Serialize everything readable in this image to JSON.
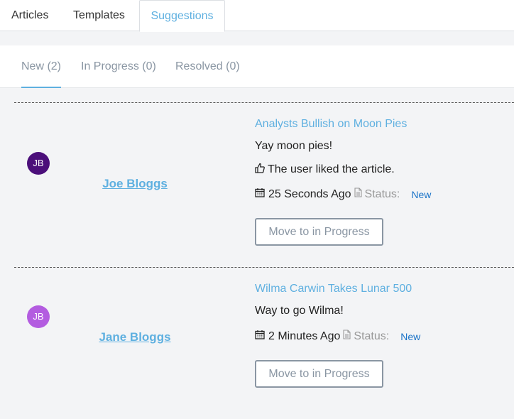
{
  "top_tabs": [
    {
      "label": "Articles"
    },
    {
      "label": "Templates"
    },
    {
      "label": "Suggestions",
      "active": true
    }
  ],
  "sub_tabs": [
    {
      "label": "New (2)",
      "active": true
    },
    {
      "label": "In Progress (0)"
    },
    {
      "label": "Resolved (0)"
    }
  ],
  "suggestions": [
    {
      "avatar_initials": "JB",
      "avatar_color": "#4b0f7a",
      "user": "Joe Bloggs",
      "title": "Analysts Bullish on Moon Pies",
      "body": "Yay moon pies!",
      "liked_text": "The user liked the article.",
      "time": "25 Seconds Ago",
      "status_label": "Status:",
      "status_value": "New",
      "action_label": "Move to in Progress"
    },
    {
      "avatar_initials": "JB",
      "avatar_color": "#b35ce0",
      "user": "Jane Bloggs",
      "title": "Wilma Carwin Takes Lunar 500",
      "body": "Way to go Wilma!",
      "time": "2 Minutes Ago",
      "status_label": "Status:",
      "status_value": "New",
      "action_label": "Move to in Progress"
    }
  ],
  "colors": {
    "accent": "#5fb0e0",
    "status": "#1a73c8"
  }
}
